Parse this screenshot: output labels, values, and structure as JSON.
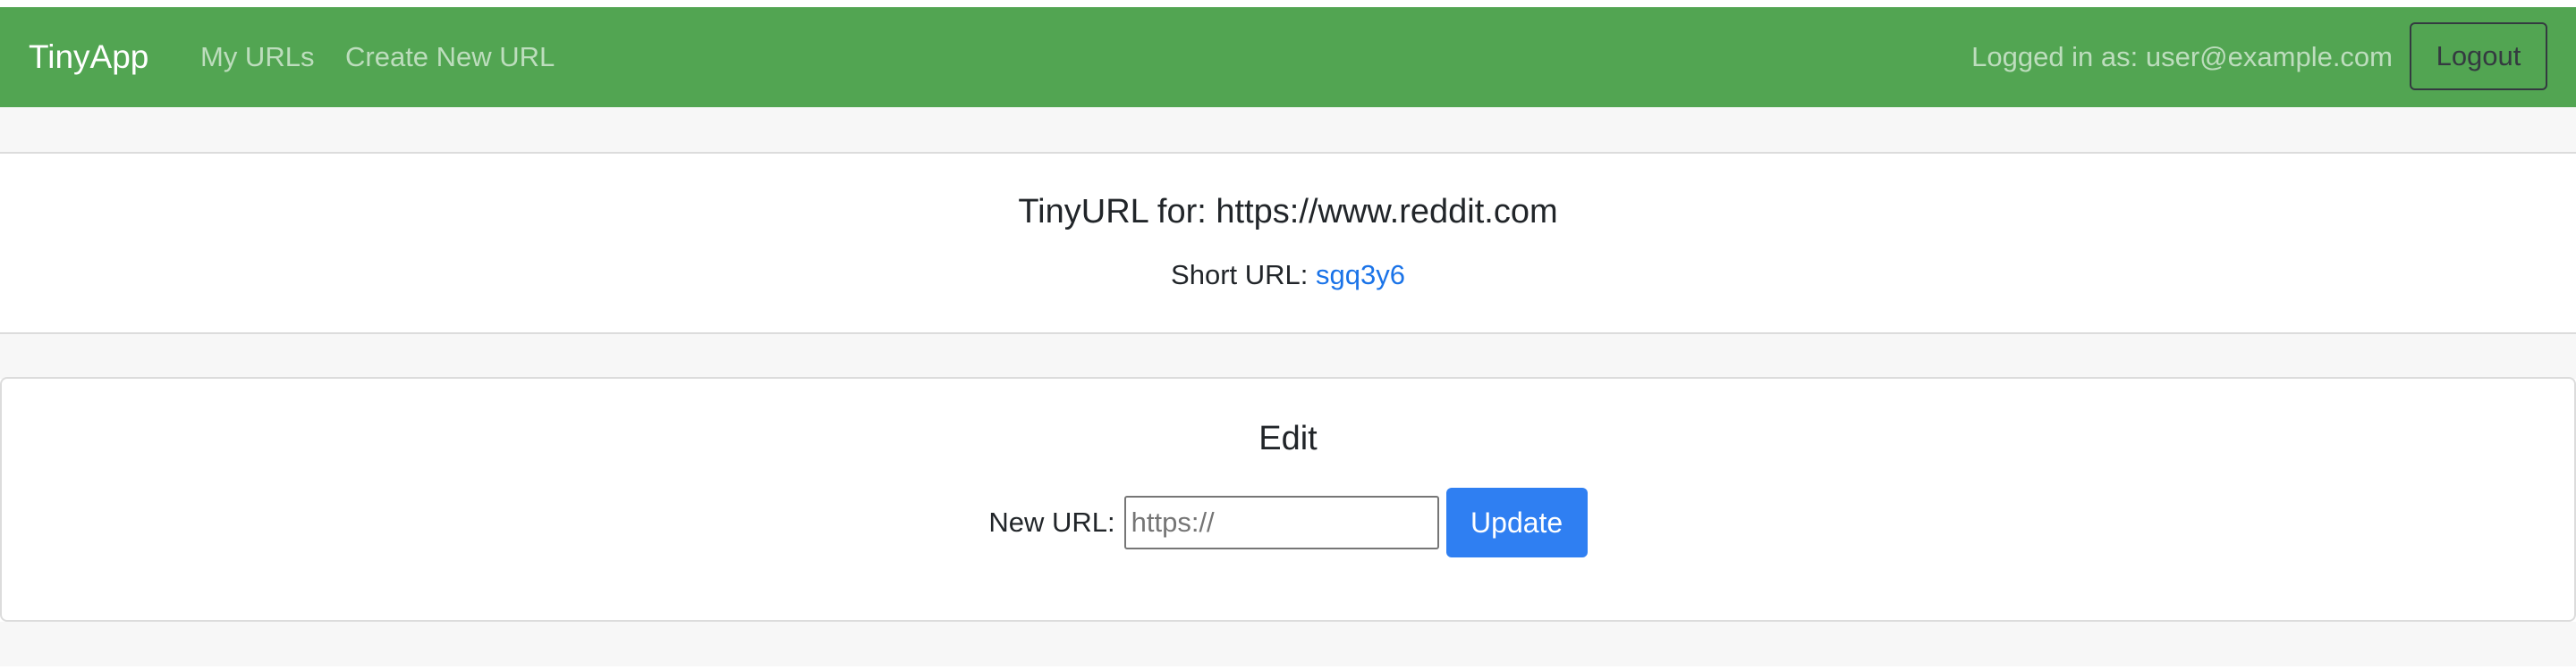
{
  "navbar": {
    "brand": "TinyApp",
    "links": [
      "My URLs",
      "Create New URL"
    ],
    "logged_in_text": "Logged in as: user@example.com",
    "logout_label": "Logout"
  },
  "tinyurl_card": {
    "title": "TinyURL for: https://www.reddit.com",
    "short_url_label": "Short URL: ",
    "short_url_value": "sgq3y6"
  },
  "edit_card": {
    "title": "Edit",
    "new_url_label": "New URL:",
    "input_placeholder": "https://",
    "input_value": "",
    "update_label": "Update"
  },
  "colors": {
    "navbar_bg": "#52a552",
    "link_blue": "#1a73e8",
    "button_blue": "#2f7ff2"
  }
}
